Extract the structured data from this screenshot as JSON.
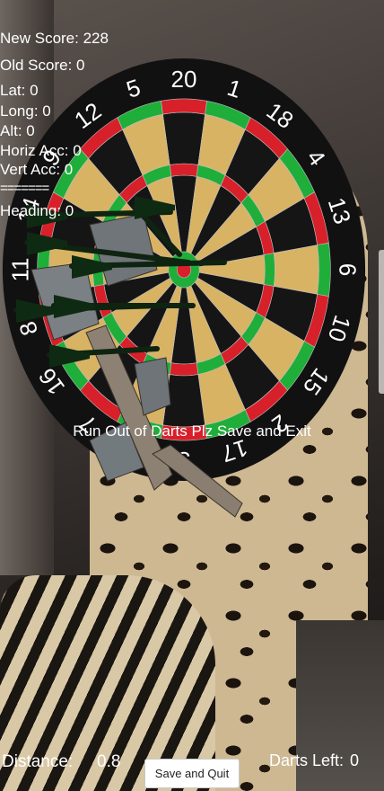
{
  "hud": {
    "new_score": "New Score: 228",
    "old_score": "Old Score: 0",
    "lat": "Lat: 0",
    "long": "Long: 0",
    "alt": "Alt: 0",
    "horiz_acc": "Horiz Acc: 0",
    "vert_acc": "Vert Acc: 0",
    "divider": "=======",
    "heading": "Heading: 0"
  },
  "message": "Run Out of Darts Plz Save and Exit",
  "bottom": {
    "distance_label": "Distance:",
    "distance_value": "0.8",
    "save_button": "Save and Quit",
    "darts_left_label": "Darts Left:",
    "darts_left_value": "0"
  },
  "board": {
    "numbers": [
      "20",
      "1",
      "18",
      "4",
      "13",
      "6",
      "10",
      "15",
      "2",
      "17",
      "3",
      "19",
      "7",
      "16",
      "8",
      "11",
      "14",
      "9",
      "12",
      "5"
    ],
    "colors": {
      "black": "#151515",
      "cream": "#d8b363",
      "red": "#d8202a",
      "green": "#1fae3a",
      "surround": "#111111",
      "wire": "#bfbfbf"
    }
  },
  "darts": {
    "count_visible": 7,
    "flight_color": "#0f2a12"
  }
}
